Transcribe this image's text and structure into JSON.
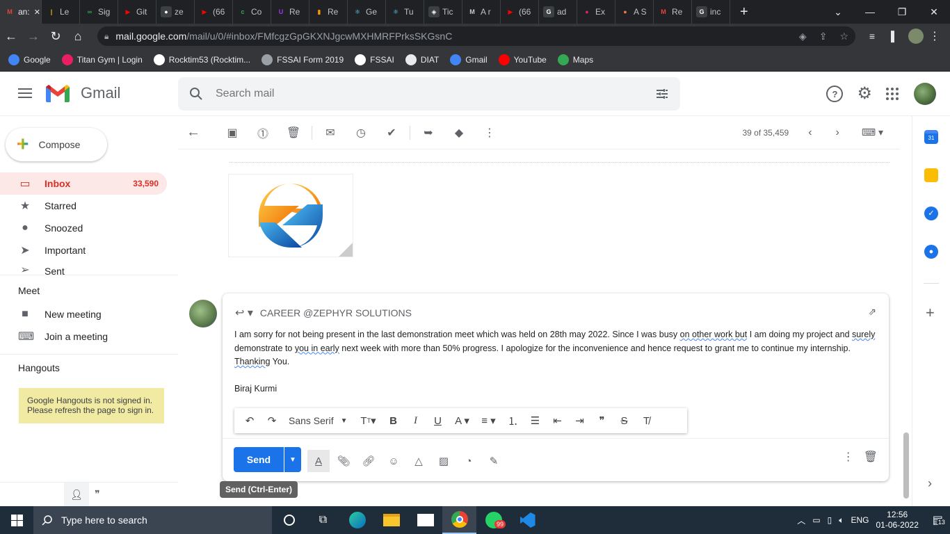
{
  "browser": {
    "tabs": [
      {
        "label": "an:",
        "icon": "gmail-icon",
        "color": "#ea4335",
        "glyph": "M",
        "active": true
      },
      {
        "label": "Le",
        "icon": "chart-icon",
        "color": "#f4b400",
        "glyph": "|"
      },
      {
        "label": "Sig",
        "icon": "link-icon",
        "color": "#34a853",
        "glyph": "∞"
      },
      {
        "label": "Git",
        "icon": "youtube-icon",
        "color": "#ff0000",
        "glyph": "▶"
      },
      {
        "label": "ze",
        "icon": "github-icon",
        "color": "#ffffff",
        "glyph": "●"
      },
      {
        "label": "(66",
        "icon": "youtube-icon",
        "color": "#ff0000",
        "glyph": "▶"
      },
      {
        "label": "Co",
        "icon": "c-icon",
        "color": "#34a853",
        "glyph": "c"
      },
      {
        "label": "Re",
        "icon": "udemy-icon",
        "color": "#a435f0",
        "glyph": "U"
      },
      {
        "label": "Re",
        "icon": "bookmark-icon",
        "color": "#ff9800",
        "glyph": "▮"
      },
      {
        "label": "Ge",
        "icon": "react-icon",
        "color": "#61dafb",
        "glyph": "⚛"
      },
      {
        "label": "Tu",
        "icon": "react-icon",
        "color": "#61dafb",
        "glyph": "⚛"
      },
      {
        "label": "Tic",
        "icon": "codepen-icon",
        "color": "#ffffff",
        "glyph": "◈"
      },
      {
        "label": "A r",
        "icon": "m-icon",
        "color": "#cccccc",
        "glyph": "M"
      },
      {
        "label": "(66",
        "icon": "youtube-icon",
        "color": "#ff0000",
        "glyph": "▶"
      },
      {
        "label": "ad",
        "icon": "google-icon",
        "color": "#ffffff",
        "glyph": "G"
      },
      {
        "label": "Ex",
        "icon": "circle-icon",
        "color": "#e91e63",
        "glyph": "●"
      },
      {
        "label": "A S",
        "icon": "circle-icon",
        "color": "#ff7043",
        "glyph": "●"
      },
      {
        "label": "Re",
        "icon": "gmail-icon",
        "color": "#ea4335",
        "glyph": "M"
      },
      {
        "label": "inc",
        "icon": "google-icon",
        "color": "#ffffff",
        "glyph": "G"
      }
    ],
    "url_host": "mail.google.com",
    "url_path": "/mail/u/0/#inbox/FMfcgzGpGKXNJgcwMXHMRFPrksSKGsnC",
    "bookmarks": [
      {
        "label": "Google",
        "color": "#4285f4"
      },
      {
        "label": "Titan Gym | Login",
        "color": "#e91e63"
      },
      {
        "label": "Rocktim53 (Rocktim...",
        "color": "#ffffff"
      },
      {
        "label": "FSSAI Form 2019",
        "color": "#9aa0a6"
      },
      {
        "label": "FSSAI",
        "color": "#ffffff"
      },
      {
        "label": "DIAT",
        "color": "#e8eaed"
      },
      {
        "label": "Gmail",
        "color": "#4285f4"
      },
      {
        "label": "YouTube",
        "color": "#ff0000"
      },
      {
        "label": "Maps",
        "color": "#34a853"
      }
    ]
  },
  "gmail": {
    "wordmark": "Gmail",
    "search_placeholder": "Search mail",
    "compose_label": "Compose",
    "nav": [
      {
        "label": "Inbox",
        "count": "33,590",
        "icon": "inbox-icon",
        "glyph": "▭",
        "active": true
      },
      {
        "label": "Starred",
        "count": "",
        "icon": "star-icon",
        "glyph": "★"
      },
      {
        "label": "Snoozed",
        "count": "",
        "icon": "clock-icon",
        "glyph": "●"
      },
      {
        "label": "Important",
        "count": "",
        "icon": "important-icon",
        "glyph": "➤"
      },
      {
        "label": "Sent",
        "count": "",
        "icon": "send-icon",
        "glyph": "➢"
      }
    ],
    "meet_title": "Meet",
    "meet_items": [
      {
        "label": "New meeting",
        "icon": "video-icon",
        "glyph": "■"
      },
      {
        "label": "Join a meeting",
        "icon": "keyboard-icon",
        "glyph": "⌨"
      }
    ],
    "hangouts_title": "Hangouts",
    "hangouts_message": "Google Hangouts is not signed in. Please refresh the page to sign in.",
    "pager": "39 of 35,459",
    "reply_to": "CAREER @ZEPHYR SOLUTIONS",
    "body_p1": "I am sorry for not being present in the last demonstration meet which was held on 28th may 2022. Since I was busy ",
    "body_p1_spell": "on other work but",
    "body_p1b": " I am doing my project and ",
    "body_p1_spell2": "surely",
    "body_p1c": " demonstrate to ",
    "body_p1_spell3": "you in early",
    "body_p1d": " next week with more than 50% progress. I apologize for the inconvenience and hence request to grant me to continue my internship.",
    "body_thanks_spell": "Thanking",
    "body_thanks": " You.",
    "signature": "Biraj Kurmi",
    "font_name": "Sans Serif",
    "send_label": "Send",
    "send_tooltip": "Send (Ctrl-Enter)"
  },
  "taskbar": {
    "search_placeholder": "Type here to search",
    "language": "ENG",
    "time": "12:56",
    "date": "01-06-2022",
    "notification_count": "13",
    "whatsapp_badge": "99"
  }
}
